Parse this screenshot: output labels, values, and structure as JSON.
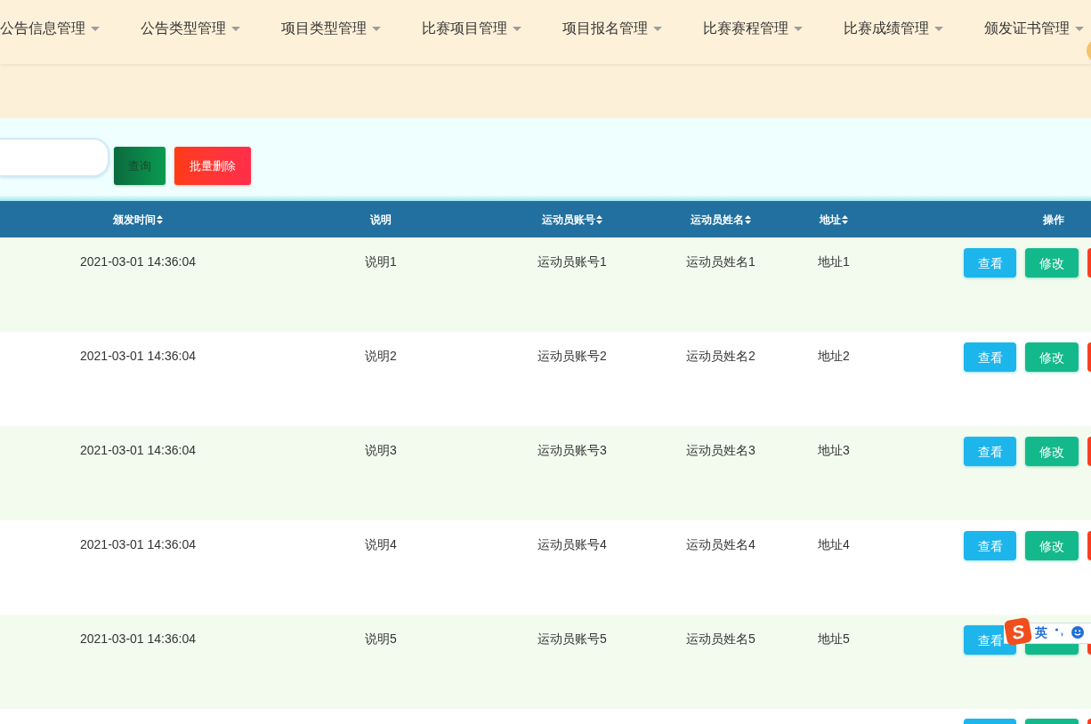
{
  "nav": {
    "items": [
      "公告信息管理",
      "公告类型管理",
      "项目类型管理",
      "比赛项目管理",
      "项目报名管理",
      "比赛赛程管理",
      "比赛成绩管理",
      "颁发证书管理"
    ]
  },
  "toolbar": {
    "search_button": "查询",
    "batch_delete_button": "批量删除"
  },
  "table": {
    "columns": [
      {
        "label": "颁发时间",
        "sortable": true
      },
      {
        "label": "说明",
        "sortable": false
      },
      {
        "label": "运动员账号",
        "sortable": true
      },
      {
        "label": "运动员姓名",
        "sortable": true
      },
      {
        "label": "地址",
        "sortable": true
      },
      {
        "label": "操作",
        "sortable": false
      }
    ],
    "rows": [
      {
        "cells": [
          "2021-03-01 14:36:04",
          "说明1",
          "运动员账号1",
          "运动员姓名1",
          "地址1"
        ],
        "actions": [
          {
            "kind": "view",
            "label": "查看"
          },
          {
            "kind": "edit",
            "label": "修改"
          },
          {
            "kind": "delete"
          }
        ]
      },
      {
        "cells": [
          "2021-03-01 14:36:04",
          "说明2",
          "运动员账号2",
          "运动员姓名2",
          "地址2"
        ],
        "actions": [
          {
            "kind": "view",
            "label": "查看"
          },
          {
            "kind": "edit",
            "label": "修改"
          },
          {
            "kind": "delete"
          }
        ]
      },
      {
        "cells": [
          "2021-03-01 14:36:04",
          "说明3",
          "运动员账号3",
          "运动员姓名3",
          "地址3"
        ],
        "actions": [
          {
            "kind": "view",
            "label": "查看"
          },
          {
            "kind": "edit",
            "label": "修改"
          },
          {
            "kind": "delete"
          }
        ]
      },
      {
        "cells": [
          "2021-03-01 14:36:04",
          "说明4",
          "运动员账号4",
          "运动员姓名4",
          "地址4"
        ],
        "actions": [
          {
            "kind": "view",
            "label": "查看"
          },
          {
            "kind": "edit",
            "label": "修改"
          },
          {
            "kind": "delete"
          }
        ]
      },
      {
        "cells": [
          "2021-03-01 14:36:04",
          "说明5",
          "运动员账号5",
          "运动员姓名5",
          "地址5"
        ],
        "actions": [
          {
            "kind": "view",
            "label": "查看"
          },
          {
            "kind": "edit"
          },
          {
            "kind": "delete"
          }
        ]
      },
      {
        "actions": [
          {
            "kind": "view"
          },
          {
            "kind": "edit"
          },
          {
            "kind": "delete"
          }
        ]
      }
    ]
  },
  "ime_toolbar": {
    "logo": "S",
    "mode": "英"
  }
}
